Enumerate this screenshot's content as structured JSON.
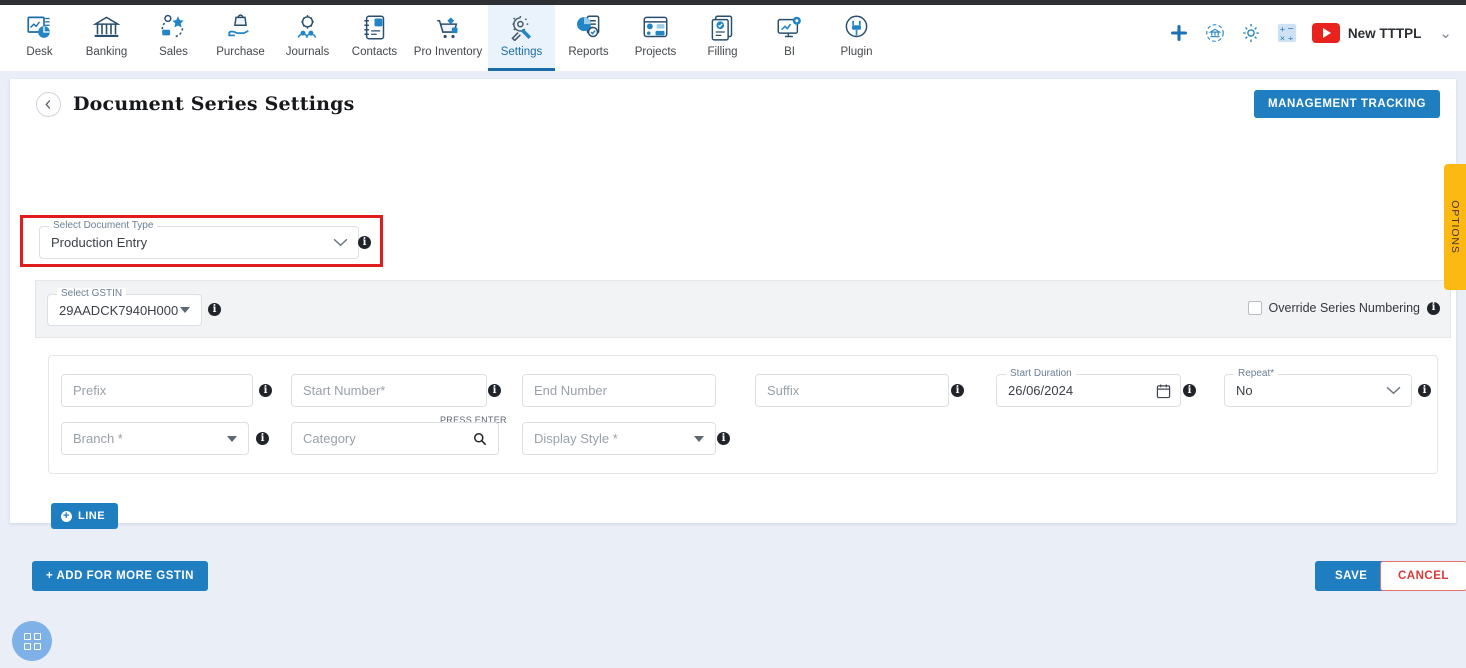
{
  "nav": {
    "items": [
      {
        "label": "Desk",
        "icon": "desk-analytics-icon",
        "active": false
      },
      {
        "label": "Banking",
        "icon": "bank-icon",
        "active": false
      },
      {
        "label": "Sales",
        "icon": "sales-icon",
        "active": false
      },
      {
        "label": "Purchase",
        "icon": "purchase-hand-icon",
        "active": false
      },
      {
        "label": "Journals",
        "icon": "journals-icon",
        "active": false
      },
      {
        "label": "Contacts",
        "icon": "contacts-icon",
        "active": false
      },
      {
        "label": "Pro Inventory",
        "icon": "inventory-cart-icon",
        "active": false
      },
      {
        "label": "Settings",
        "icon": "settings-tools-icon",
        "active": true
      },
      {
        "label": "Reports",
        "icon": "reports-pie-icon",
        "active": false
      },
      {
        "label": "Projects",
        "icon": "projects-board-icon",
        "active": false
      },
      {
        "label": "Filling",
        "icon": "filling-docs-icon",
        "active": false
      },
      {
        "label": "BI",
        "icon": "bi-monitor-icon",
        "active": false
      },
      {
        "label": "Plugin",
        "icon": "plugin-icon",
        "active": false
      }
    ],
    "right": {
      "add_icon": "plus-icon",
      "sync_bank_icon": "bank-sync-icon",
      "settings_icon": "gear-icon",
      "calculator_icon": "calculator-icon",
      "youtube_icon": "youtube-play-icon",
      "org_name": "New TTTPL",
      "caret": "chevron-down-icon"
    }
  },
  "header": {
    "back_icon": "chevron-left-icon",
    "title": "Document Series Settings",
    "management_tracking_label": "MANAGEMENT TRACKING"
  },
  "document_type": {
    "label": "Select Document Type",
    "value": "Production Entry",
    "chevron_icon": "chevron-down-icon",
    "info_icon": "info-icon",
    "highlighted": true,
    "highlight_color": "#e01d1d"
  },
  "gstin": {
    "label": "Select GSTIN",
    "value": "29AADCK7940H000",
    "dropdown_icon": "triangle-down-icon",
    "info_icon": "info-icon"
  },
  "override": {
    "checked": false,
    "label": "Override Series Numbering",
    "info_icon": "info-icon"
  },
  "series_fields": {
    "prefix": {
      "placeholder": "Prefix",
      "value": "",
      "info": true
    },
    "start_number": {
      "placeholder": "Start Number*",
      "value": "",
      "info": true
    },
    "end_number": {
      "placeholder": "End Number",
      "value": "",
      "info": false
    },
    "suffix": {
      "placeholder": "Suffix",
      "value": "",
      "info": true
    },
    "start_duration": {
      "label": "Start Duration",
      "value": "26/06/2024",
      "icon": "calendar-icon",
      "info": true
    },
    "repeat": {
      "label": "Repeat*",
      "value": "No",
      "chevron_icon": "chevron-down-icon",
      "info": true
    },
    "branch": {
      "placeholder": "Branch *",
      "dropdown_icon": "triangle-down-icon",
      "info": true
    },
    "category": {
      "placeholder": "Category",
      "hint": "PRESS ENTER",
      "icon": "search-icon"
    },
    "display_style": {
      "placeholder": "Display Style *",
      "dropdown_icon": "triangle-down-icon",
      "info": true
    }
  },
  "buttons": {
    "line_label": "LINE",
    "line_icon": "plus-circle-icon",
    "add_for_more_gstin_label": "+ ADD FOR MORE GSTIN",
    "save_label": "SAVE",
    "cancel_label": "CANCEL"
  },
  "options_tab": {
    "label": "OPTIONS",
    "color": "#fdb913"
  },
  "fab": {
    "icon": "app-grid-icon"
  },
  "colors": {
    "primary_blue": "#1f7ec0",
    "page_background": "#e9eef7",
    "cancel_red": "#d93a3a",
    "highlight_red": "#e01d1d",
    "options_yellow": "#fdb913"
  }
}
